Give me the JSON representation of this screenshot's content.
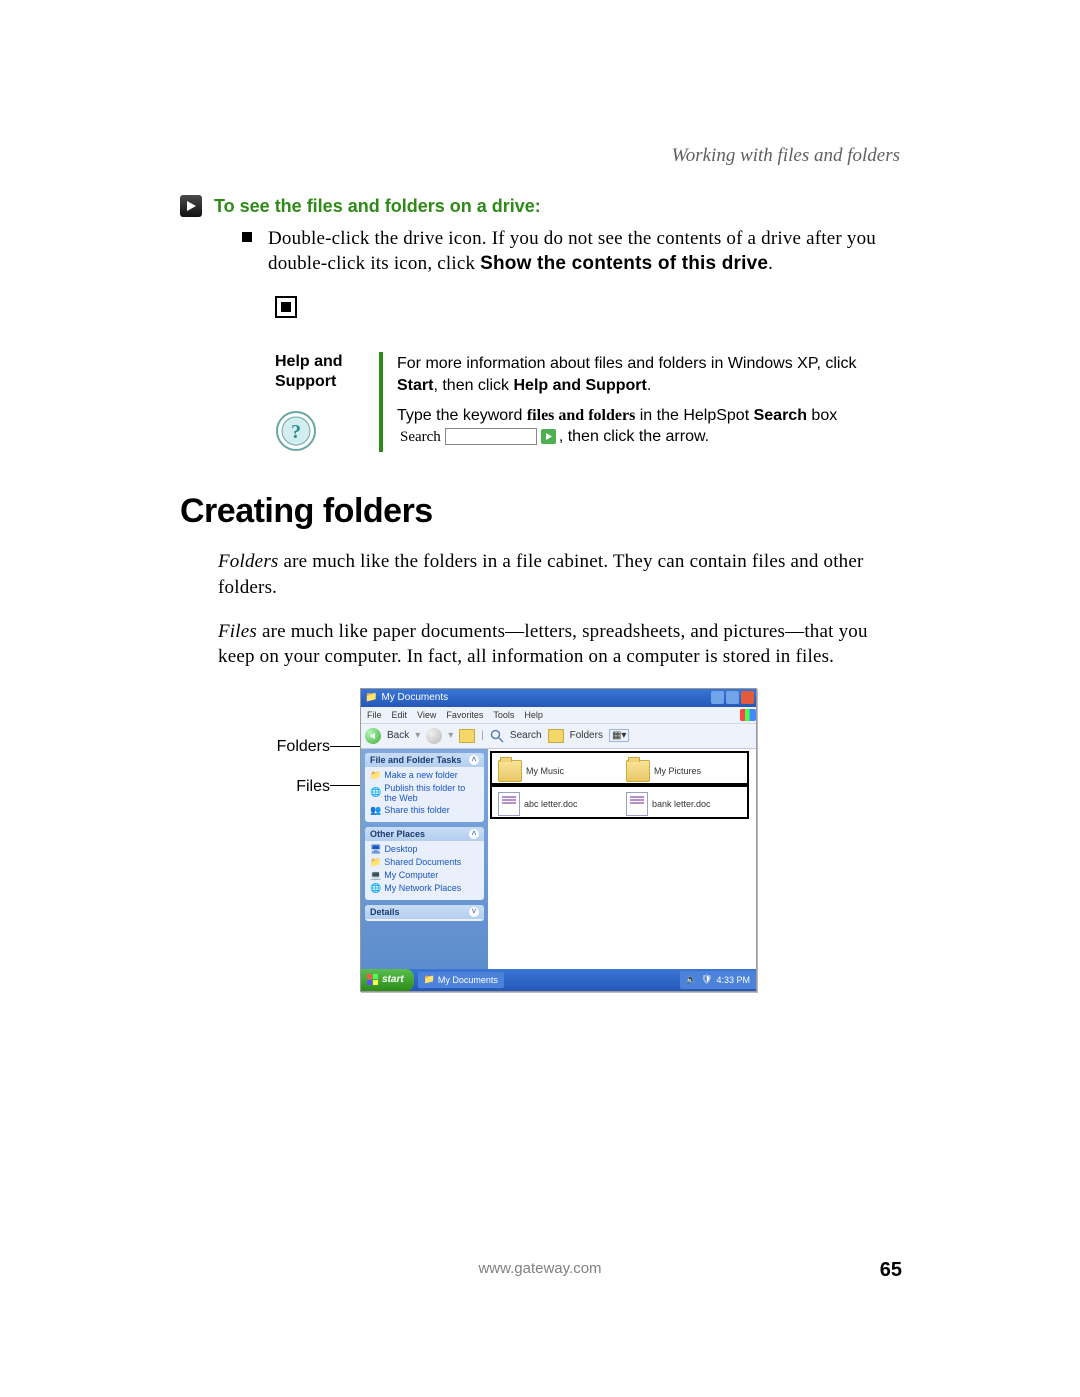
{
  "header": {
    "section_title": "Working with files and folders"
  },
  "task": {
    "heading": "To see the files and folders on a drive:",
    "bullet_pre": "Double-click the drive icon. If you do not see the contents of a drive after you double-click its icon, click ",
    "bullet_bold": "Show the contents of this drive",
    "bullet_post": "."
  },
  "help": {
    "title_l1": "Help and",
    "title_l2": "Support",
    "line1_pre": "For more information about files and folders in Windows XP, click ",
    "start": "Start",
    "line1_mid": ", then click ",
    "help_support": "Help and Support",
    "line1_end": ".",
    "line2_pre": "Type the keyword ",
    "keyword": "files and folders",
    "line2_mid": " in the HelpSpot ",
    "search_bold": "Search",
    "line2_box_pre": " box",
    "search_label": "Search",
    "line2_post": ", then click the arrow."
  },
  "section": {
    "heading": "Creating folders"
  },
  "para1": {
    "ital": "Folders",
    "text": " are much like the folders in a file cabinet. They can contain files and other folders."
  },
  "para2": {
    "ital": "Files",
    "text": " are much like paper documents—letters, spreadsheets, and pictures—that you keep on your computer. In fact, all information on a computer is stored in files."
  },
  "callouts": {
    "folders": "Folders",
    "files": "Files"
  },
  "xp": {
    "title": "My Documents",
    "menu": {
      "file": "File",
      "edit": "Edit",
      "view": "View",
      "favorites": "Favorites",
      "tools": "Tools",
      "help": "Help"
    },
    "toolbar": {
      "back": "Back",
      "search": "Search",
      "folders": "Folders"
    },
    "side_tasks": {
      "title": "File and Folder Tasks",
      "l1": "Make a new folder",
      "l2": "Publish this folder to the Web",
      "l3": "Share this folder"
    },
    "side_places": {
      "title": "Other Places",
      "l1": "Desktop",
      "l2": "Shared Documents",
      "l3": "My Computer",
      "l4": "My Network Places"
    },
    "side_details": {
      "title": "Details"
    },
    "items": {
      "folder1": "My Music",
      "folder2": "My Pictures",
      "file1": "abc letter.doc",
      "file2": "bank letter.doc"
    },
    "taskbar": {
      "start": "start",
      "item": "My Documents",
      "time": "4:33 PM"
    }
  },
  "footer": {
    "url": "www.gateway.com",
    "page": "65"
  }
}
